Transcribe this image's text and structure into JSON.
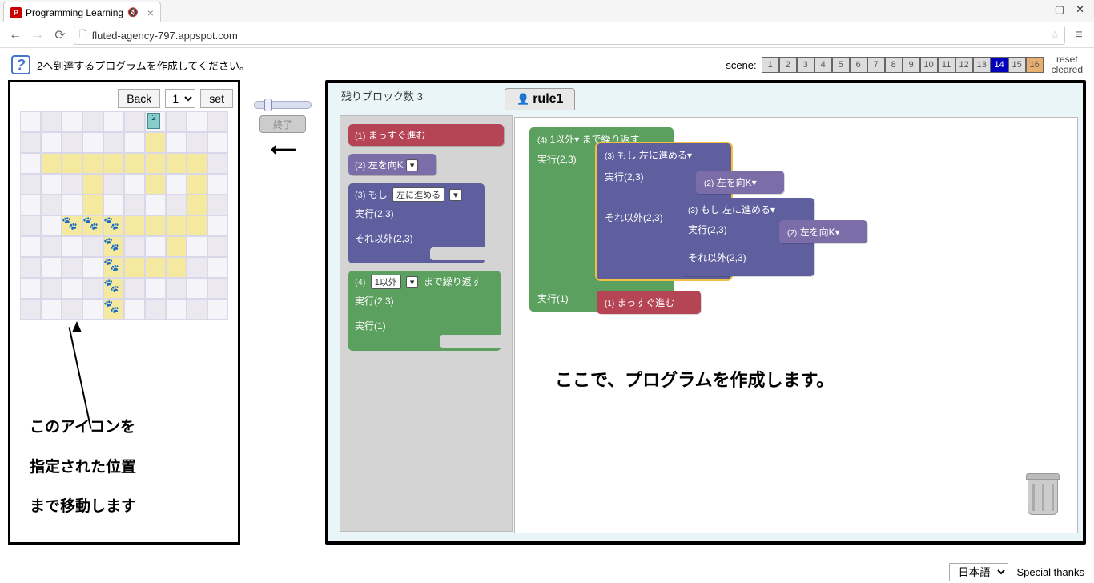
{
  "browser": {
    "tab_title": "Programming Learning",
    "url": "fluted-agency-797.appspot.com",
    "min": "—",
    "max": "▢",
    "close": "✕"
  },
  "header": {
    "instruction": "2へ到達するプログラムを作成してください。",
    "scene_label": "scene:",
    "scenes": [
      "1",
      "2",
      "3",
      "4",
      "5",
      "6",
      "7",
      "8",
      "9",
      "10",
      "11",
      "12",
      "13",
      "14",
      "15",
      "16"
    ],
    "active_scene": "14",
    "reset": "reset",
    "cleared": "cleared"
  },
  "left": {
    "back": "Back",
    "num": "1",
    "set": "set",
    "annot_l1": "このアイコンを",
    "annot_l2": "指定された位置",
    "annot_l3": "まで移動します",
    "goal": "2"
  },
  "mid": {
    "end": "終了"
  },
  "right": {
    "remaining": "残りブロック数 3",
    "rule_tab": "rule1",
    "canvas_text": "ここで、プログラムを作成します。"
  },
  "palette": {
    "b1_id": "(1)",
    "b1_txt": "まっすぐ進む",
    "b2_id": "(2)",
    "b2_txt": "左を向K",
    "b3_id": "(3)",
    "b3_txt": "もし",
    "b3_dd": "左に進める",
    "b3_exec": "実行(2,3)",
    "b3_else": "それ以外(2,3)",
    "b4_id": "(4)",
    "b4_dd": "1以外",
    "b4_txt": "まで繰り返す",
    "b4_e1": "実行(2,3)",
    "b4_e2": "実行(1)"
  },
  "canvas": {
    "g_id": "(4)",
    "g_dd": "1以外",
    "g_txt": "まで繰り返す",
    "g_exec23": "実行(2,3)",
    "i1_id": "(3)",
    "i1_txt": "もし",
    "i1_dd": "左に進める",
    "i1_exec": "実行(2,3)",
    "i1_else": "それ以外(2,3)",
    "p1_id": "(2)",
    "p1_txt": "左を向K",
    "i2_id": "(3)",
    "i2_txt": "もし",
    "i2_dd": "左に進める",
    "i2_exec": "実行(2,3)",
    "i2_else": "それ以外(2,3)",
    "p2_id": "(2)",
    "p2_txt": "左を向K",
    "g_exec1": "実行(1)",
    "r_id": "(1)",
    "r_txt": "まっすぐ進む"
  },
  "footer": {
    "lang": "日本語",
    "thanks": "Special thanks"
  }
}
